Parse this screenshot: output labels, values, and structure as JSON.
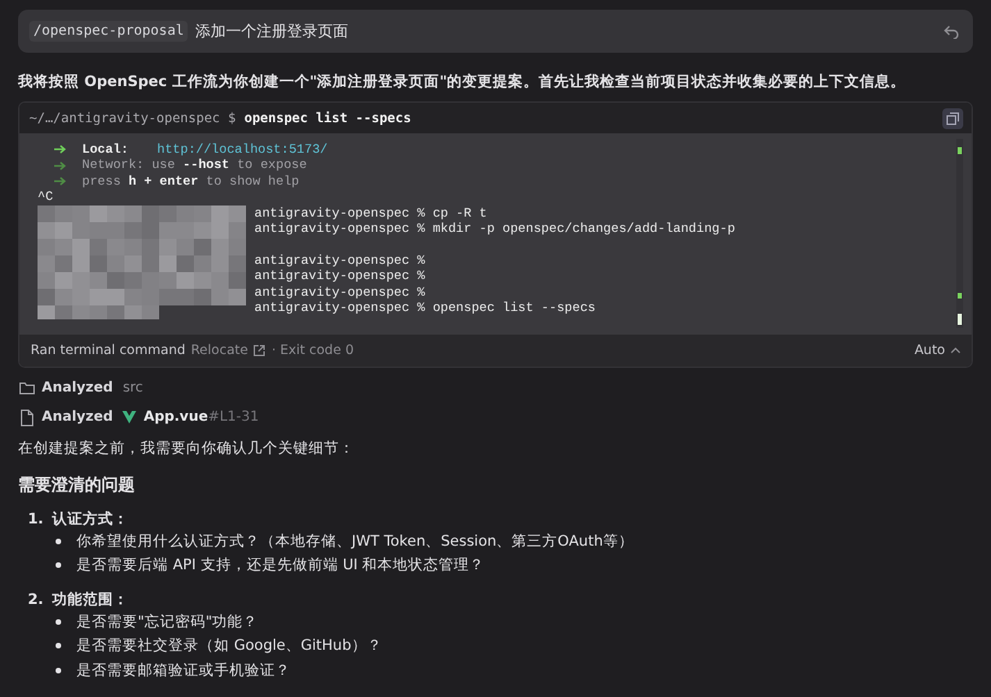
{
  "prompt": {
    "command": "/openspec-proposal",
    "text": "添加一个注册登录页面"
  },
  "intro": "我将按照 OpenSpec 工作流为你创建一个\"添加注册登录页面\"的变更提案。首先让我检查当前项目状态并收集必要的上下文信息。",
  "terminal": {
    "cwd": "~/…/antigravity-openspec $",
    "command": "openspec list --specs",
    "head": [
      {
        "kind": "server",
        "label": "Local:",
        "url": "http://localhost:5173/"
      },
      {
        "kind": "hint",
        "text": "Network: use **--host** to expose"
      },
      {
        "kind": "hint",
        "text": "press **h + enter** to show help"
      },
      {
        "kind": "plain",
        "text": "^C"
      }
    ],
    "session": [
      {
        "kind": "line",
        "text": "antigravity-openspec % cp -R t"
      },
      {
        "kind": "line",
        "text": "antigravity-openspec % mkdir -p openspec/changes/add-landing-p"
      },
      {
        "kind": "blank"
      },
      {
        "kind": "line",
        "text": "antigravity-openspec %"
      },
      {
        "kind": "line",
        "text": "antigravity-openspec %"
      },
      {
        "kind": "line",
        "text": "antigravity-openspec %"
      },
      {
        "kind": "line",
        "text": "antigravity-openspec % openspec list --specs"
      }
    ],
    "footer": {
      "label": "Ran terminal command",
      "relocate": "Relocate",
      "exit": "· Exit code 0",
      "mode": "Auto"
    }
  },
  "activity": [
    {
      "kind": "folder",
      "verb": "Analyzed",
      "target": "src"
    },
    {
      "kind": "vue-file",
      "verb": "Analyzed",
      "target": "App.vue",
      "range": "#L1-31"
    }
  ],
  "lead": "在创建提案之前，我需要向你确认几个关键细节：",
  "heading": "需要澄清的问题",
  "questions": [
    {
      "number": "1.",
      "title": "认证方式：",
      "items": [
        "你希望使用什么认证方式？（本地存储、JWT Token、Session、第三方OAuth等）",
        "是否需要后端 API 支持，还是先做前端 UI 和本地状态管理？"
      ]
    },
    {
      "number": "2.",
      "title": "功能范围：",
      "items": [
        "是否需要\"忘记密码\"功能？",
        "是否需要社交登录（如 Google、GitHub）？",
        "是否需要邮箱验证或手机验证？"
      ]
    }
  ]
}
